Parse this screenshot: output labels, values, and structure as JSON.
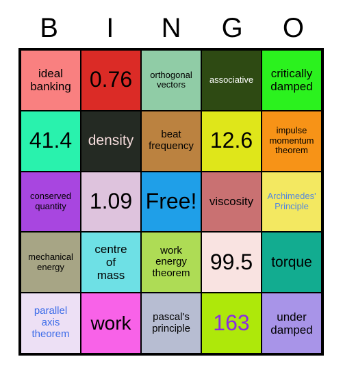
{
  "card": {
    "title": "BINGO",
    "header_letters": [
      "B",
      "I",
      "N",
      "G",
      "O"
    ],
    "rows": 5,
    "columns": 5,
    "grid_border_color": "#000000",
    "page_background": "#ffffff",
    "header_text_color": "#000000"
  },
  "cells": [
    {
      "id": "r1c1",
      "row": 1,
      "col": 1,
      "column_letter": "B",
      "text": "ideal\nbanking",
      "bg": "#F98080",
      "fg": "#000000",
      "size": "m",
      "free": false
    },
    {
      "id": "r1c2",
      "row": 1,
      "col": 2,
      "column_letter": "I",
      "text": "0.76",
      "bg": "#DB2B26",
      "fg": "#000000",
      "size": "xxl",
      "free": false
    },
    {
      "id": "r1c3",
      "row": 1,
      "col": 3,
      "column_letter": "N",
      "text": "orthogonal\nvectors",
      "bg": "#90CCA6",
      "fg": "#000000",
      "size": "xs",
      "free": false
    },
    {
      "id": "r1c4",
      "row": 1,
      "col": 4,
      "column_letter": "G",
      "text": "associative",
      "bg": "#2E4A13",
      "fg": "#FFFFFF",
      "size": "xs",
      "free": false
    },
    {
      "id": "r1c5",
      "row": 1,
      "col": 5,
      "column_letter": "O",
      "text": "critically\ndamped",
      "bg": "#2BF21E",
      "fg": "#000000",
      "size": "m",
      "free": false
    },
    {
      "id": "r2c1",
      "row": 2,
      "col": 1,
      "column_letter": "B",
      "text": "41.4",
      "bg": "#29F2AD",
      "fg": "#000000",
      "size": "xxl",
      "free": false
    },
    {
      "id": "r2c2",
      "row": 2,
      "col": 2,
      "column_letter": "I",
      "text": "density",
      "bg": "#242A23",
      "fg": "#F5DCDC",
      "size": "l",
      "free": false
    },
    {
      "id": "r2c3",
      "row": 2,
      "col": 3,
      "column_letter": "N",
      "text": "beat\nfrequency",
      "bg": "#BB8240",
      "fg": "#000000",
      "size": "s",
      "free": false
    },
    {
      "id": "r2c4",
      "row": 2,
      "col": 4,
      "column_letter": "G",
      "text": "12.6",
      "bg": "#DFE61A",
      "fg": "#000000",
      "size": "xxl",
      "free": false
    },
    {
      "id": "r2c5",
      "row": 2,
      "col": 5,
      "column_letter": "O",
      "text": "impulse\nmomentum\ntheorem",
      "bg": "#F79317",
      "fg": "#000000",
      "size": "xs",
      "free": false
    },
    {
      "id": "r3c1",
      "row": 3,
      "col": 1,
      "column_letter": "B",
      "text": "conserved\nquantity",
      "bg": "#A846E0",
      "fg": "#000000",
      "size": "xs",
      "free": false
    },
    {
      "id": "r3c2",
      "row": 3,
      "col": 2,
      "column_letter": "I",
      "text": "1.09",
      "bg": "#DEC3DD",
      "fg": "#000000",
      "size": "xxl",
      "free": false
    },
    {
      "id": "r3c3",
      "row": 3,
      "col": 3,
      "column_letter": "N",
      "text": "Free!",
      "bg": "#1F9FE8",
      "fg": "#000000",
      "size": "xxl",
      "free": true
    },
    {
      "id": "r3c4",
      "row": 3,
      "col": 4,
      "column_letter": "G",
      "text": "viscosity",
      "bg": "#C97172",
      "fg": "#000000",
      "size": "m",
      "free": false
    },
    {
      "id": "r3c5",
      "row": 3,
      "col": 5,
      "column_letter": "O",
      "text": "Archimedes'\nPrinciple",
      "bg": "#F3E861",
      "fg": "#5588DD",
      "size": "xs",
      "free": false
    },
    {
      "id": "r4c1",
      "row": 4,
      "col": 1,
      "column_letter": "B",
      "text": "mechanical\nenergy",
      "bg": "#A7A585",
      "fg": "#000000",
      "size": "xs",
      "free": false
    },
    {
      "id": "r4c2",
      "row": 4,
      "col": 2,
      "column_letter": "I",
      "text": "centre\nof\nmass",
      "bg": "#6EE0E5",
      "fg": "#000000",
      "size": "m",
      "free": false
    },
    {
      "id": "r4c3",
      "row": 4,
      "col": 3,
      "column_letter": "N",
      "text": "work\nenergy\ntheorem",
      "bg": "#AEDC55",
      "fg": "#000000",
      "size": "s",
      "free": false
    },
    {
      "id": "r4c4",
      "row": 4,
      "col": 4,
      "column_letter": "G",
      "text": "99.5",
      "bg": "#F9E3E1",
      "fg": "#000000",
      "size": "xxl",
      "free": false
    },
    {
      "id": "r4c5",
      "row": 4,
      "col": 5,
      "column_letter": "O",
      "text": "torque",
      "bg": "#12AC90",
      "fg": "#000000",
      "size": "l",
      "free": false
    },
    {
      "id": "r5c1",
      "row": 5,
      "col": 1,
      "column_letter": "B",
      "text": "parallel\naxis\ntheorem",
      "bg": "#EDE0F5",
      "fg": "#3B6BE8",
      "size": "s",
      "free": false
    },
    {
      "id": "r5c2",
      "row": 5,
      "col": 2,
      "column_letter": "I",
      "text": "work",
      "bg": "#F862E8",
      "fg": "#000000",
      "size": "xl",
      "free": false
    },
    {
      "id": "r5c3",
      "row": 5,
      "col": 3,
      "column_letter": "N",
      "text": "pascal's\nprinciple",
      "bg": "#B7BDD2",
      "fg": "#000000",
      "size": "s",
      "free": false
    },
    {
      "id": "r5c4",
      "row": 5,
      "col": 4,
      "column_letter": "G",
      "text": "163",
      "bg": "#AEE80A",
      "fg": "#8A2BE2",
      "size": "xxl",
      "free": false
    },
    {
      "id": "r5c5",
      "row": 5,
      "col": 5,
      "column_letter": "O",
      "text": "under\ndamped",
      "bg": "#A894E8",
      "fg": "#000000",
      "size": "m",
      "free": false
    }
  ]
}
